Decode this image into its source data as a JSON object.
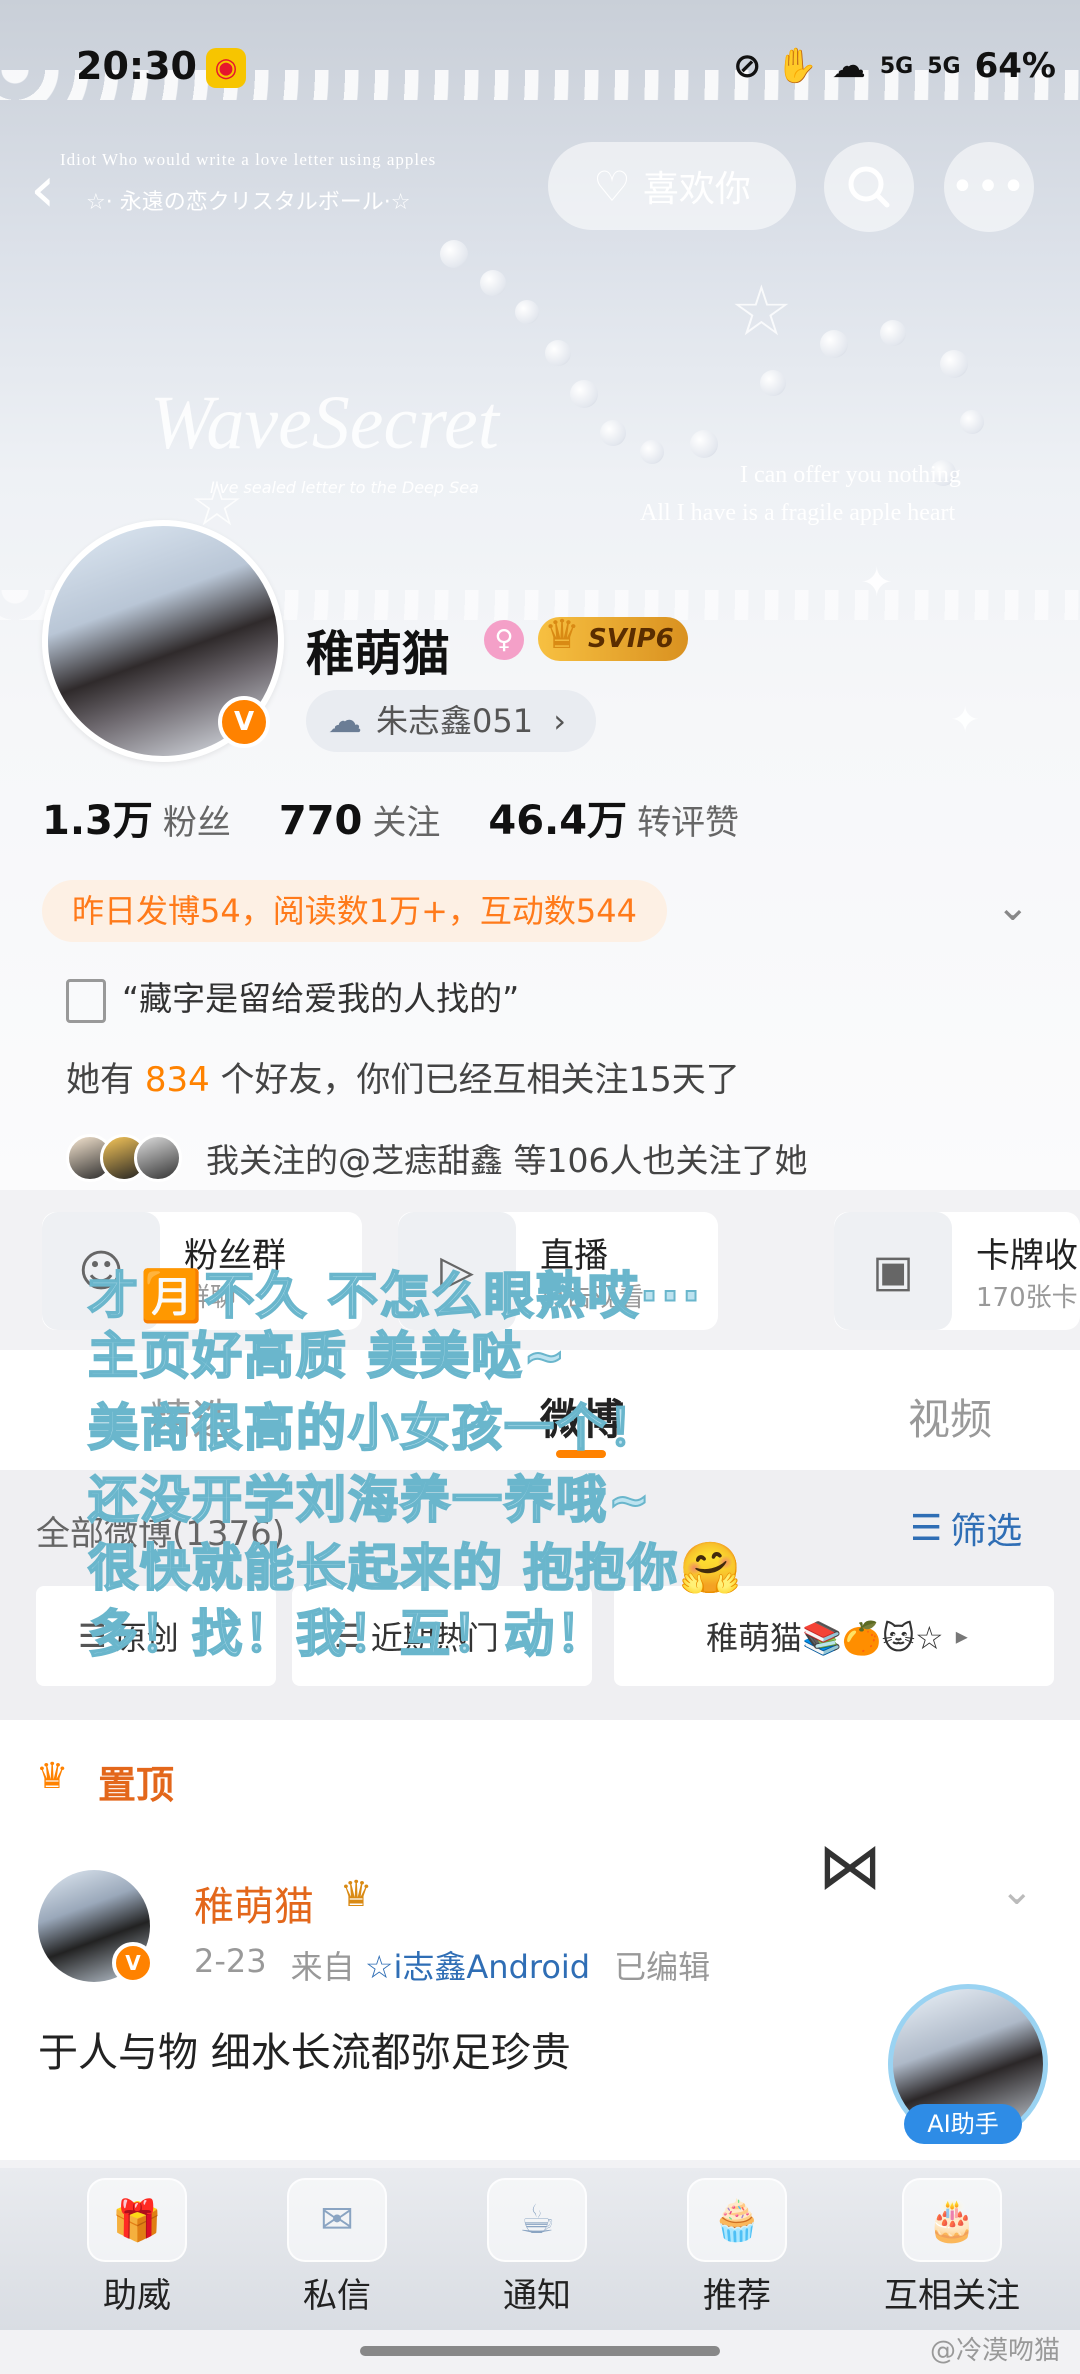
{
  "status_bar": {
    "time": "20:30",
    "battery": "64%",
    "signal1": "5G",
    "signal2": "5G"
  },
  "header": {
    "like_label": "喜欢你",
    "back_icon": "back-arrow-icon",
    "search_icon": "search-icon",
    "more_icon": "more-icon"
  },
  "background_texts": {
    "line1": "Idiot Who would write a love letter using apples",
    "line2": "☆· 永遠の恋クリスタルボール·☆",
    "brand": "WaveSecret",
    "brand_sub": "I've sealed letter to the Deep Sea",
    "quote1": "I can offer you nothing",
    "quote2": "All I have is a fragile apple heart"
  },
  "profile": {
    "name": "稚萌猫",
    "vip": "SVIP6",
    "fan_group": "朱志鑫051",
    "fans_count": "1.3万",
    "fans_label": "粉丝",
    "follow_count": "770",
    "follow_label": "关注",
    "interact_count": "46.4万",
    "interact_label": "转评赞",
    "activity": "昨日发博54，阅读数1万+，互动数544",
    "bio": "“藏字是留给爱我的人找的”",
    "friends_prefix": "她有",
    "friends_count": "834",
    "friends_suffix": "个好友，你们已经互相关注15天了",
    "mutual_text": "我关注的@芝痣甜鑫 等106人也关注了她"
  },
  "cards": [
    {
      "title": "粉丝群",
      "sub": "群聊"
    },
    {
      "title": "直播",
      "sub": "点击观看"
    },
    {
      "title": "卡牌收",
      "sub": "170张卡"
    }
  ],
  "tabs": {
    "weibo": "微博",
    "video": "视频",
    "tab1": "精选"
  },
  "filter": {
    "all_label": "全部微博(1376)",
    "filter_label": "筛选",
    "chips": [
      "原创",
      "近期热门",
      "稚萌猫📚🍊🐱☆"
    ]
  },
  "overlay_lines": [
    "才🈷️不久 不怎么眼熟哎···",
    "主页好高质 美美哒~",
    "美商很高的小女孩一个！",
    "还没开学刘海养一养哦~",
    "很快就能长起来的 抱抱你🤗",
    "多！找！我！互！动！"
  ],
  "pinned": {
    "label": "置顶"
  },
  "post": {
    "author": "稚萌猫",
    "date": "2-23",
    "source_prefix": "来自",
    "source": "☆i志鑫Android",
    "edited": "已编辑",
    "content": "于人与物 细水长流都弥足珍贵"
  },
  "ai_helper": {
    "label": "AI助手"
  },
  "bottom_nav": [
    {
      "label": "助威",
      "icon": "gift-icon"
    },
    {
      "label": "私信",
      "icon": "message-icon"
    },
    {
      "label": "通知",
      "icon": "teapot-icon"
    },
    {
      "label": "推荐",
      "icon": "cupcake-icon"
    },
    {
      "label": "互相关注",
      "icon": "cake-icon"
    }
  ],
  "watermark": "@冷漠吻猫",
  "colors": {
    "accent": "#ff8200",
    "overlay_text": "#bde3f0",
    "overlay_stroke": "#6ab6cc"
  }
}
